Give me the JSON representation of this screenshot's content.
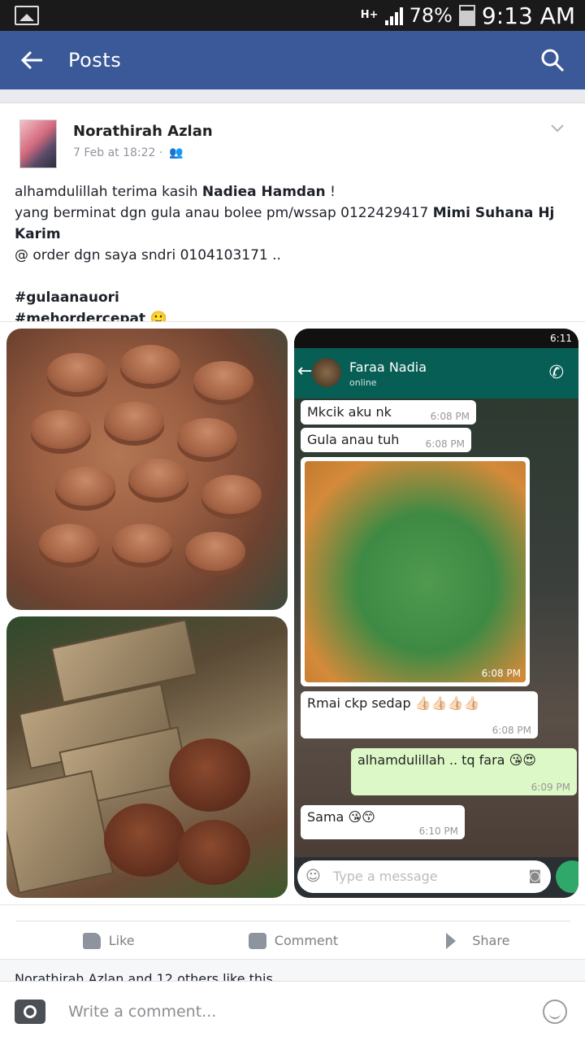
{
  "status_bar": {
    "network": "H+",
    "battery": "78%",
    "time": "9:13 AM"
  },
  "app_bar": {
    "title": "Posts"
  },
  "post": {
    "author": "Norathirah Azlan",
    "date": "7 Feb at 18:22 ·",
    "line1_prefix": "alhamdulillah terima kasih ",
    "line1_mention": "Nadiea Hamdan",
    "line1_suffix": " !",
    "line2_prefix": "yang berminat dgn gula anau bolee pm/wssap 0122429417 ",
    "line2_mention": "Mimi Suhana Hj Karim",
    "line3": "@ order dgn saya sndri 0104103171 ..",
    "hashtag1": "#gulaanauori",
    "hashtag2": "#mehordercepat"
  },
  "screenshot": {
    "contact_name": "Faraa Nadia",
    "contact_status": "online",
    "messages": [
      {
        "text": "Mkcik aku nk",
        "time": "6:08 PM"
      },
      {
        "text": "Gula anau tuh",
        "time": "6:08 PM"
      },
      {
        "text": "",
        "time": "6:08 PM"
      },
      {
        "text": "Rmai ckp sedap 👍🏻👍🏻👍🏻👍🏻",
        "time": "6:08 PM"
      },
      {
        "text": "alhamdulillah .. tq fara 😘😍",
        "time": "6:09 PM"
      },
      {
        "text": "Sama 😘😙",
        "time": "6:10 PM"
      }
    ],
    "input_placeholder": "Type a message"
  },
  "actions": {
    "like": "Like",
    "comment": "Comment",
    "share": "Share"
  },
  "likes_summary": "Norathirah Azlan and 12 others like this",
  "composer": {
    "placeholder": "Write a comment..."
  }
}
